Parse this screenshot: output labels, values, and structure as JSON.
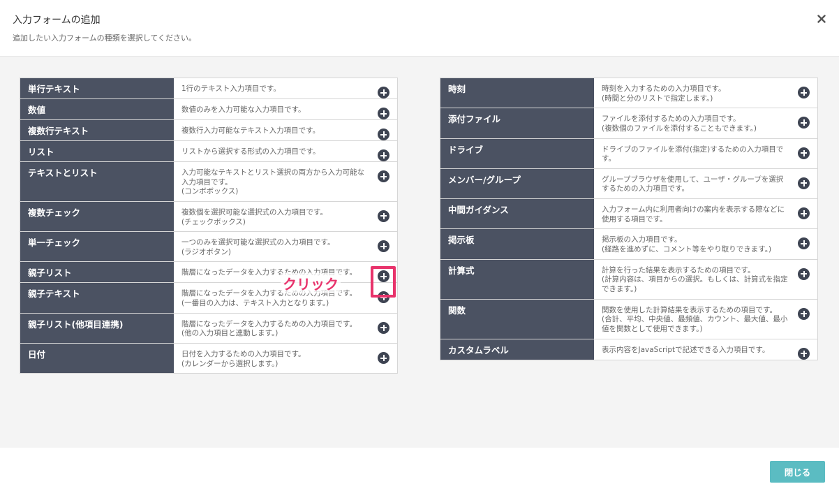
{
  "header": {
    "title": "入力フォームの追加",
    "subtitle": "追加したい入力フォームの種類を選択してください。"
  },
  "left_items": [
    {
      "name": "単行テキスト",
      "desc": "1行のテキスト入力項目です。"
    },
    {
      "name": "数値",
      "desc": "数値のみを入力可能な入力項目です。"
    },
    {
      "name": "複数行テキスト",
      "desc": "複数行入力可能なテキスト入力項目です。"
    },
    {
      "name": "リスト",
      "desc": "リストから選択する形式の入力項目です。"
    },
    {
      "name": "テキストとリスト",
      "desc": "入力可能なテキストとリスト選択の両方から入力可能な\n入力項目です。\n(コンボボックス)"
    },
    {
      "name": "複数チェック",
      "desc": "複数個を選択可能な選択式の入力項目です。\n(チェックボックス)"
    },
    {
      "name": "単一チェック",
      "desc": "一つのみを選択可能な選択式の入力項目です。\n(ラジオボタン)"
    },
    {
      "name": "親子リスト",
      "desc": "階層になったデータを入力するための入力項目です。"
    },
    {
      "name": "親子テキスト",
      "desc": "階層になったデータを入力するための入力項目です。\n(一番目の入力は、テキスト入力となります。)"
    },
    {
      "name": "親子リスト(他項目連携)",
      "desc": "階層になったデータを入力するための入力項目です。\n(他の入力項目と連動します。)"
    },
    {
      "name": "日付",
      "desc": "日付を入力するための入力項目です。\n(カレンダーから選択します。)"
    }
  ],
  "right_items": [
    {
      "name": "時刻",
      "desc": "時刻を入力するための入力項目です。\n(時間と分のリストで指定します。)"
    },
    {
      "name": "添付ファイル",
      "desc": "ファイルを添付するための入力項目です。\n(複数個のファイルを添付することもできます。)"
    },
    {
      "name": "ドライブ",
      "desc": "ドライブのファイルを添付(指定)するための入力項目で\nす。"
    },
    {
      "name": "メンバー/グループ",
      "desc": "グループブラウザを使用して、ユーザ・グループを選択\nするための入力項目です。"
    },
    {
      "name": "中間ガイダンス",
      "desc": "入力フォーム内に利用者向けの案内を表示する際などに\n使用する項目です。"
    },
    {
      "name": "掲示板",
      "desc": "掲示板の入力項目です。\n(経路を進めずに、コメント等をやり取りできます。)"
    },
    {
      "name": "計算式",
      "desc": "計算を行った結果を表示するための項目です。\n(計算内容は、項目からの選択。もしくは、計算式を指定\nできます。)"
    },
    {
      "name": "関数",
      "desc": "関数を使用した計算結果を表示するための項目です。\n(合計、平均、中央値、最頻値、カウント、最大値、最小\n値を関数として使用できます。)"
    },
    {
      "name": "カスタムラベル",
      "desc": "表示内容をJavaScriptで記述できる入力項目です。"
    }
  ],
  "annotation": {
    "click_label": "クリック"
  },
  "footer": {
    "close_label": "閉じる"
  },
  "icons": {
    "close": "close-icon",
    "add": "plus-circle-icon"
  },
  "colors": {
    "label_bg": "#4b5262",
    "add_icon": "#3e4452",
    "highlight": "#e8336b",
    "button": "#5bbcc2"
  }
}
